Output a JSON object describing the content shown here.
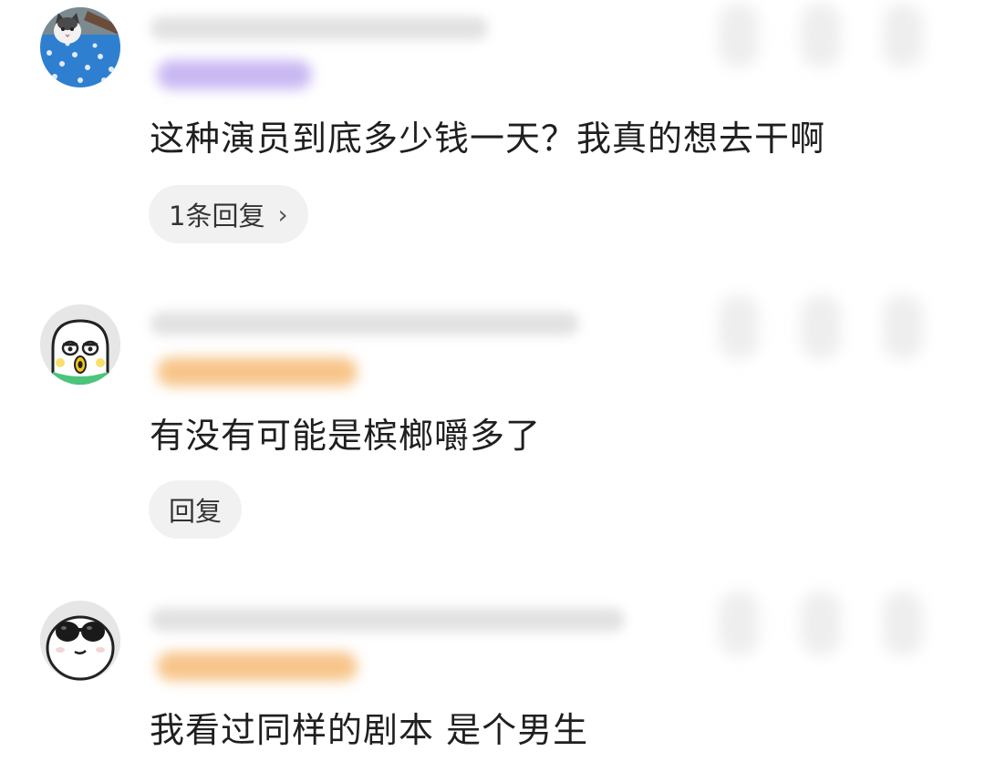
{
  "comments": [
    {
      "avatar_icon": "cat-avatar-icon",
      "text": "这种演员到底多少钱一天？我真的想去干啊",
      "reply_label": "1条回复",
      "reply_chevron": "›"
    },
    {
      "avatar_icon": "cartoon-chick-avatar-icon",
      "text": "有没有可能是槟榔嚼多了",
      "reply_label": "回复",
      "reply_chevron": ""
    },
    {
      "avatar_icon": "sunglasses-face-avatar-icon",
      "text": "我看过同样的剧本 是个男生",
      "reply_label": "",
      "reply_chevron": ""
    }
  ],
  "colors": {
    "background": "#ffffff",
    "text": "#1f1f1f",
    "reply_pill": "#f1f1f1",
    "badge_purple": "#c9b8f2",
    "badge_orange": "#f7c58a"
  }
}
